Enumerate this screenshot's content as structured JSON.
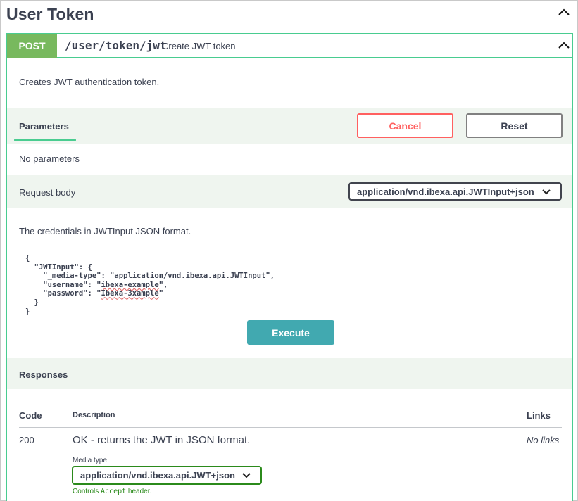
{
  "section": {
    "title": "User Token"
  },
  "operation": {
    "method": "POST",
    "path": "/user/token/jwt",
    "summary": "Create JWT token",
    "description": "Creates JWT authentication token."
  },
  "parameters": {
    "tab_label": "Parameters",
    "cancel_label": "Cancel",
    "reset_label": "Reset",
    "empty_text": "No parameters"
  },
  "request_body": {
    "label": "Request body",
    "content_type": "application/vnd.ibexa.api.JWTInput+json",
    "description": "The credentials in JWTInput JSON format.",
    "example": {
      "l1": "{",
      "l2": "  \"JWTInput\": {",
      "l3": "    \"_media-type\": \"application/vnd.ibexa.api.JWTInput\",",
      "l4_pre": "    \"username\": \"",
      "l4_val": "ibexa-example",
      "l4_post": "\",",
      "l5_pre": "    \"password\": \"",
      "l5_val": "Ibexa-3xample",
      "l5_post": "\"",
      "l6": "  }",
      "l7": "}"
    }
  },
  "execute_label": "Execute",
  "responses": {
    "title": "Responses",
    "columns": {
      "code": "Code",
      "description": "Description",
      "links": "Links"
    },
    "rows": [
      {
        "code": "200",
        "description": "OK - returns the JWT in JSON format.",
        "links": "No links",
        "media_type_label": "Media type",
        "media_type": "application/vnd.ibexa.api.JWT+json",
        "hint_pre": "Controls ",
        "hint_code": "Accept",
        "hint_post": " header."
      }
    ]
  },
  "colors": {
    "post": "#78b95e",
    "accent_border": "#49cc90",
    "cancel": "#ff6060",
    "execute": "#41a9b0",
    "band": "#eff5ef",
    "media_green": "#2b8a1b"
  },
  "icons": {
    "section_toggle": "chevron-up-icon",
    "operation_toggle": "chevron-up-icon",
    "select_arrow": "chevron-down-icon"
  }
}
